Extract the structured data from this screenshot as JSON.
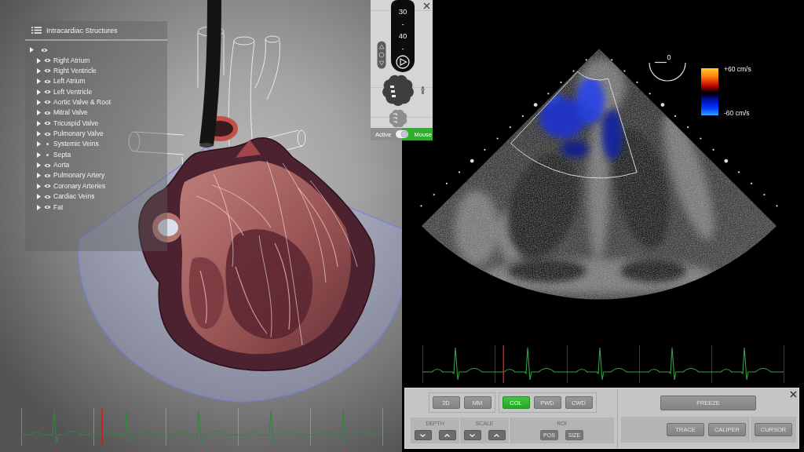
{
  "structure_tree": {
    "title": "Intracardiac Structures",
    "root": {
      "expanded": false,
      "visible": true,
      "children": [
        {
          "label": "Right Atrium",
          "expanded": false,
          "visible": true
        },
        {
          "label": "Right Ventricle",
          "expanded": false,
          "visible": true
        },
        {
          "label": "Left Atrium",
          "expanded": false,
          "visible": true
        },
        {
          "label": "Left Ventricle",
          "expanded": false,
          "visible": true
        },
        {
          "label": "Aortic Valve & Root",
          "expanded": false,
          "visible": true
        },
        {
          "label": "Mitral Valve",
          "expanded": false,
          "visible": true
        },
        {
          "label": "Tricuspid Valve",
          "expanded": false,
          "visible": true
        },
        {
          "label": "Pulmonary Valve",
          "expanded": false,
          "visible": true
        },
        {
          "label": "Systemic Veins",
          "expanded": false,
          "visible": false
        },
        {
          "label": "Septa",
          "expanded": false,
          "visible": false
        },
        {
          "label": "Aorta",
          "expanded": false,
          "visible": true
        },
        {
          "label": "Pulmonary Artery",
          "expanded": false,
          "visible": true
        },
        {
          "label": "Coronary Arteries",
          "expanded": false,
          "visible": true
        },
        {
          "label": "Cardiac Veins",
          "expanded": false,
          "visible": true
        },
        {
          "label": "Fat",
          "expanded": false,
          "visible": true
        }
      ]
    }
  },
  "probe_panel": {
    "multiplane_scale": [
      "30",
      "-",
      "40",
      "-"
    ],
    "mode_toggle": [
      {
        "label": "Active",
        "selected": false
      },
      {
        "label": "Mouse",
        "selected": true
      }
    ]
  },
  "echo_view": {
    "angle": "0",
    "color_scale": {
      "max_label": "+60 cm/s",
      "min_label": "-60 cm/s"
    }
  },
  "control_panel": {
    "mode_groups": [
      {
        "buttons": [
          {
            "label": "2D",
            "selected": false
          },
          {
            "label": "MM",
            "selected": false
          }
        ]
      },
      {
        "buttons": [
          {
            "label": "COL",
            "selected": true
          },
          {
            "label": "PWD",
            "selected": false
          },
          {
            "label": "CWD",
            "selected": false
          }
        ]
      }
    ],
    "adjusters": [
      {
        "label": "DEPTH",
        "kind": "stepper"
      },
      {
        "label": "SCALE",
        "kind": "stepper"
      },
      {
        "label": "ROI",
        "kind": "buttons",
        "buttons": [
          "POS",
          "SIZE"
        ]
      }
    ],
    "freeze": "FREEZE",
    "tools": [
      {
        "buttons": [
          "TRACE",
          "CALIPER"
        ]
      },
      {
        "buttons": [
          "CURSOR"
        ]
      }
    ]
  }
}
